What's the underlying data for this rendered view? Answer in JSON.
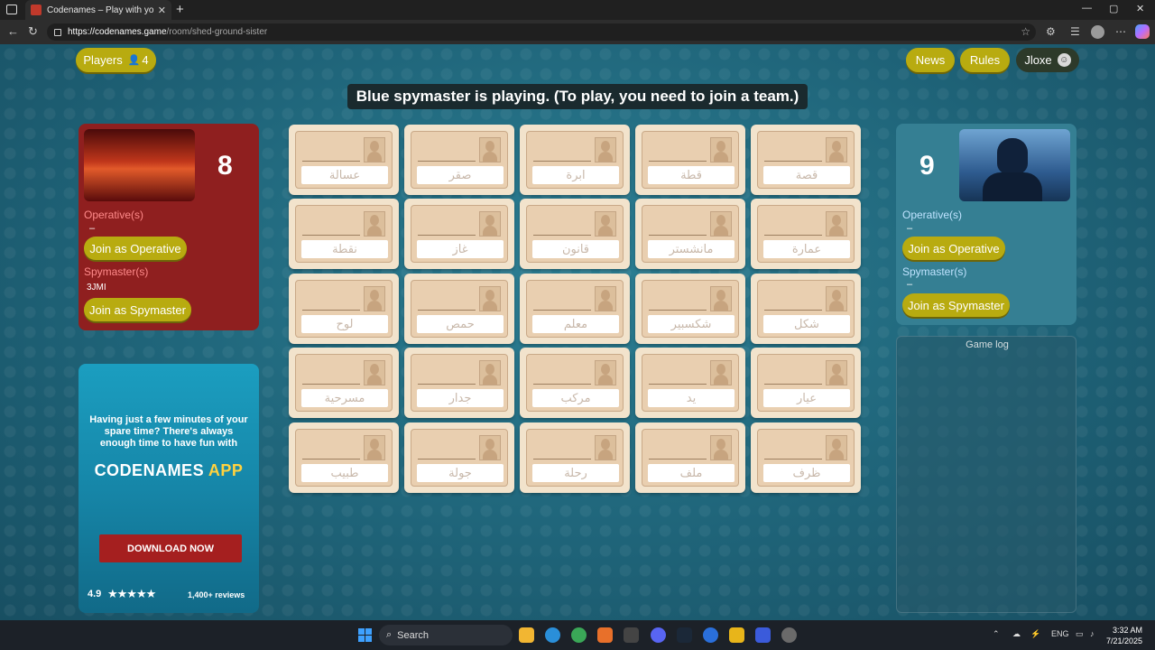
{
  "browser": {
    "tab_title": "Codenames – Play with your Frie",
    "url_host": "https://codenames.game",
    "url_path": "/room/shed-ground-sister",
    "controls": {
      "minimize": "—",
      "restore": "▢",
      "close": "✕"
    }
  },
  "header": {
    "players_label": "Players",
    "players_count": "4",
    "news_label": "News",
    "rules_label": "Rules",
    "user_name": "Jloxe"
  },
  "status_message": "Blue spymaster is playing. (To play, you need to join a team.)",
  "red_team": {
    "score": "8",
    "operatives_label": "Operative(s)",
    "operatives_value": "–",
    "join_operative": "Join as Operative",
    "spymasters_label": "Spymaster(s)",
    "spymaster_name": "3JMI",
    "join_spymaster": "Join as Spymaster"
  },
  "blue_team": {
    "score": "9",
    "operatives_label": "Operative(s)",
    "operatives_value": "–",
    "join_operative": "Join as Operative",
    "spymasters_label": "Spymaster(s)",
    "spymasters_value": "–",
    "join_spymaster": "Join as Spymaster"
  },
  "board": {
    "cards": [
      "عسالة",
      "صقر",
      "ابرة",
      "قطة",
      "قصة",
      "نقطة",
      "غاز",
      "قانون",
      "مانشستر",
      "عمارة",
      "لوح",
      "حمص",
      "معلم",
      "شكسبير",
      "شكل",
      "مسرحية",
      "جدار",
      "مركب",
      "يد",
      "عيار",
      "طبيب",
      "جولة",
      "رحلة",
      "ملف",
      "ظرف"
    ]
  },
  "game_log": {
    "title": "Game log"
  },
  "ad": {
    "tagline": "Having just a few minutes of your spare time? There's always enough time to have fun with",
    "logo_main": "CODENAMES",
    "logo_app": "APP",
    "download": "DOWNLOAD NOW",
    "rating": "4.9",
    "stars": "★★★★★",
    "reviews": "1,400+ reviews"
  },
  "taskbar": {
    "search_label": "Search",
    "lang": "ENG",
    "time": "3:32 AM",
    "date": "7/21/2025"
  },
  "colors": {
    "red_team": "#8f1f1f",
    "blue_team": "#357f93",
    "button_yellow": "#b8ab10",
    "card_bg": "#f2e3cc"
  }
}
